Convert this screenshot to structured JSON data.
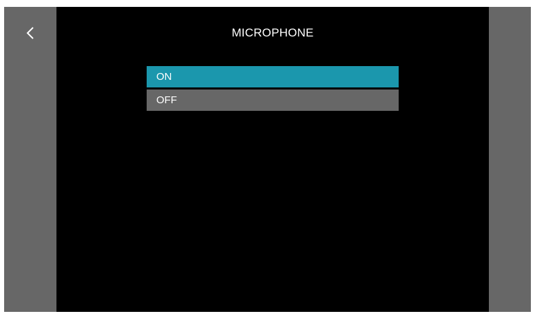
{
  "header": {
    "title": "MICROPHONE",
    "back_icon": "chevron-left-icon"
  },
  "options": [
    {
      "label": "ON",
      "selected": true
    },
    {
      "label": "OFF",
      "selected": false
    }
  ],
  "colors": {
    "background": "#000000",
    "side_panel": "#676767",
    "selected": "#1b97ad",
    "unselected": "#676767",
    "text": "#ffffff"
  }
}
